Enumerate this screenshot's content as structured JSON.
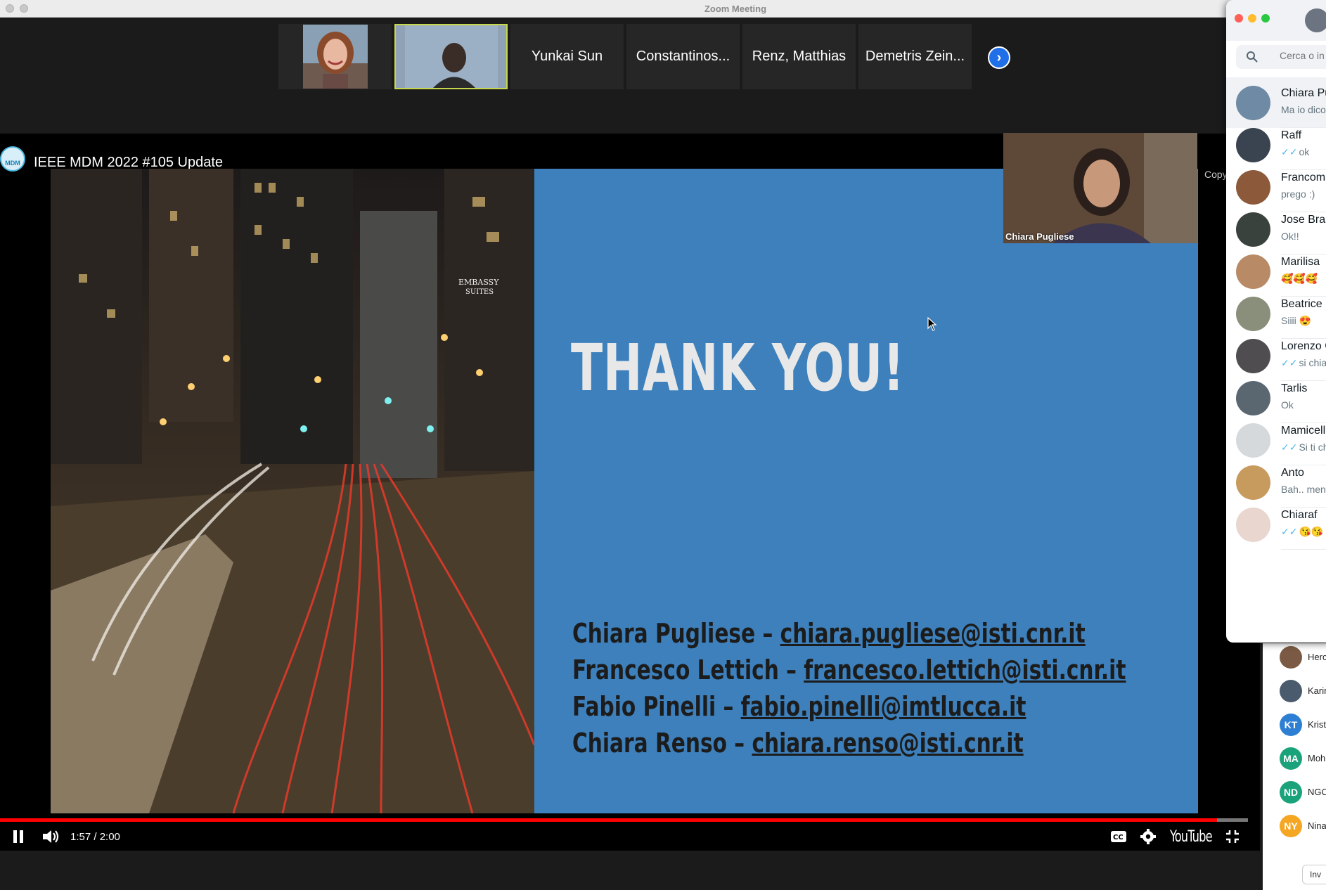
{
  "zoom": {
    "window_title": "Zoom Meeting",
    "participants": [
      {
        "name": "",
        "type": "photo"
      },
      {
        "name": "",
        "type": "photo"
      },
      {
        "name": "Yunkai Sun"
      },
      {
        "name": "Constantinos..."
      },
      {
        "name": "Renz,  Matthias"
      },
      {
        "name": "Demetris Zein..."
      }
    ],
    "next_icon": "chevron-right-icon",
    "speaker_overlay_name": "Chiara Pugliese",
    "copy_label": "Copy"
  },
  "video": {
    "title": "IEEE MDM 2022 #105 Update",
    "channel_logo_text": "MDM",
    "slide": {
      "photo_sign": "EMBASSY SUITES",
      "heading": "THANK YOU!",
      "contacts": [
        {
          "name": "Chiara Pugliese",
          "email": "chiara.pugliese@isti.cnr.it"
        },
        {
          "name": "Francesco Lettich",
          "email": "francesco.lettich@isti.cnr.it"
        },
        {
          "name": "Fabio Pinelli",
          "email": "fabio.pinelli@imtlucca.it"
        },
        {
          "name": "Chiara Renso",
          "email": "chiara.renso@isti.cnr.it"
        }
      ]
    },
    "time": "1:57 / 2:00",
    "progress": 0.975,
    "brand": "YouTube"
  },
  "participant_list": [
    {
      "name": "Herc",
      "initials": "",
      "color": "#7a5a44"
    },
    {
      "name": "Karin",
      "initials": "",
      "color": "#4a5b6d"
    },
    {
      "name": "Krist",
      "initials": "KT",
      "color": "#2d7fd3"
    },
    {
      "name": "Moh",
      "initials": "MA",
      "color": "#1aa37a"
    },
    {
      "name": "NGC",
      "initials": "ND",
      "color": "#1aa37a"
    },
    {
      "name": "Nina",
      "initials": "NY",
      "color": "#f5a623"
    }
  ],
  "participant_invite": "Inv",
  "chat": {
    "search_placeholder": "Cerca o in",
    "items": [
      {
        "name": "Chiara Pu",
        "message": "Ma io dico",
        "read": false,
        "avatar_color": "#6e8aa4"
      },
      {
        "name": "Raff",
        "message": "ok",
        "read": true,
        "avatar_color": "#3a4450"
      },
      {
        "name": "Francoma",
        "message": "prego :)",
        "read": false,
        "avatar_color": "#8c5a3a"
      },
      {
        "name": "Jose Bras",
        "message": "Ok!!",
        "read": false,
        "avatar_color": "#39423c"
      },
      {
        "name": "Marilisa",
        "message": "🥰🥰🥰",
        "read": false,
        "avatar_color": "#b98a66"
      },
      {
        "name": "Beatrice",
        "message": "Siiii 😍",
        "read": false,
        "avatar_color": "#8a8f7c"
      },
      {
        "name": "Lorenzo G",
        "message": "si chiar",
        "read": true,
        "avatar_color": "#504d50"
      },
      {
        "name": "Tarlis",
        "message": "Ok",
        "read": false,
        "avatar_color": "#5a6770"
      },
      {
        "name": "Mamicell",
        "message": "Si ti ch",
        "read": true,
        "avatar_color": "#d5d9dc"
      },
      {
        "name": "Anto",
        "message": "Bah.. men",
        "read": false,
        "avatar_color": "#c79a5e"
      },
      {
        "name": "Chiaraf",
        "message": "😘😘",
        "read": true,
        "avatar_color": "#e8d6cf"
      }
    ]
  }
}
